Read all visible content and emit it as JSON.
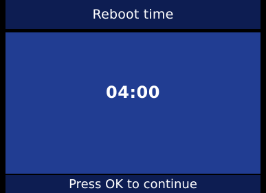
{
  "header": {
    "title": "Reboot time"
  },
  "main": {
    "time_value": "04:00"
  },
  "footer": {
    "hint": "Press OK to continue"
  },
  "colors": {
    "title_bar_bg": "#0d1d52",
    "content_bg": "#213d92",
    "footer_bar_bg": "#0d1d52",
    "text": "#ffffff"
  }
}
